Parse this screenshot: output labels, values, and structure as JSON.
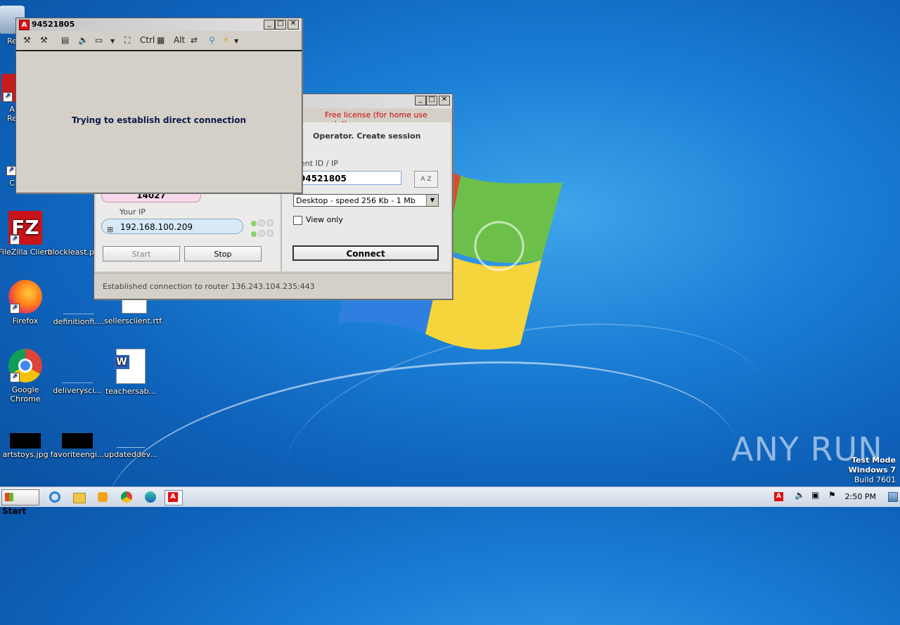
{
  "desktop": {
    "icons": [
      {
        "label": "Re"
      },
      {
        "label": "A\nRe"
      },
      {
        "label": "C"
      },
      {
        "label": "FileZilla Client"
      },
      {
        "label": "blockleast.p..."
      },
      {
        "label": "Firefox"
      },
      {
        "label": "definitionfi...."
      },
      {
        "label": "sellersclient.rtf"
      },
      {
        "label": "Google\nChrome"
      },
      {
        "label": "deliverysci..."
      },
      {
        "label": "teachersab..."
      },
      {
        "label": "artstoys.jpg"
      },
      {
        "label": "favoriteengi..."
      },
      {
        "label": "updateddev..."
      }
    ],
    "watermark": "ANY RUN",
    "test_mode": {
      "line1": "Test Mode",
      "line2": "Windows 7",
      "line3": "Build 7601"
    }
  },
  "viewer_window": {
    "title": "94521805",
    "toolbar": {
      "ctrl": "Ctrl",
      "alt": "Alt"
    },
    "message": "Trying to establish direct connection"
  },
  "ammyy_window": {
    "license": "Free license (for home use only!)",
    "operator_title": "Operator. Create session",
    "client_label": "ent ID / IP",
    "client_value": "94521805",
    "az_label": "A Z",
    "speed": "Desktop - speed  256 Kb - 1 Mb",
    "view_only": "View only",
    "connect": "Connect",
    "your_id": "14027",
    "your_ip_label": "Your IP",
    "your_ip": "192.168.100.209",
    "start": "Start",
    "stop": "Stop",
    "status": "Established connection to router 136.243.104.235:443"
  },
  "taskbar": {
    "start": "Start",
    "clock": "2:50 PM"
  }
}
